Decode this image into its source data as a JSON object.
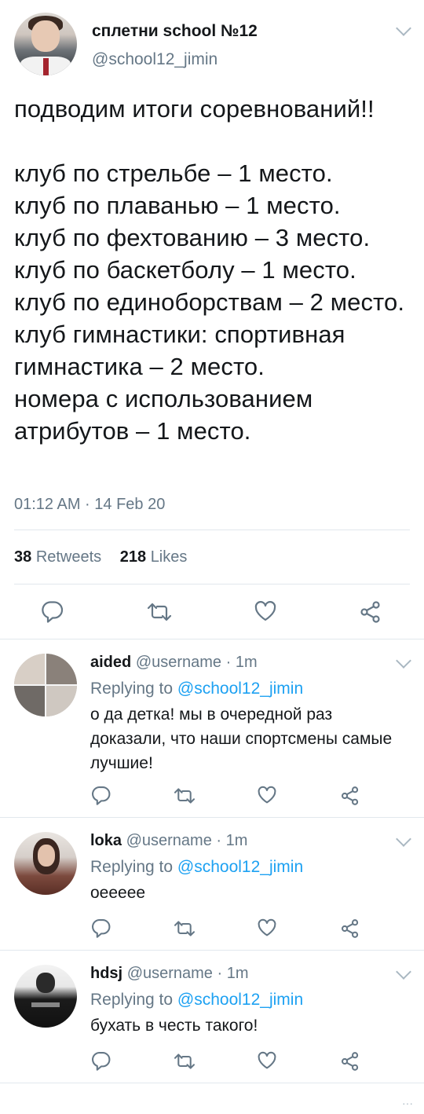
{
  "main_tweet": {
    "display_name": "сплетни school №12",
    "handle": "@school12_jimin",
    "text": "подводим итоги соревнований!!\n\nклуб по стрельбе – 1 место.\nклуб по плаванью – 1 место.\nклуб по фехтованию – 3 место.\nклуб по баскетболу – 1 место.\nклуб по единоборствам – 2 место.\nклуб гимнастики: спортивная гимнастика – 2 место.\nномера с использованием атрибутов – 1 место.",
    "timestamp": "01:12 AM · 14 Feb 20",
    "retweets_count": "38",
    "retweets_label": "Retweets",
    "likes_count": "218",
    "likes_label": "Likes"
  },
  "icons": {
    "reply": "reply-icon",
    "retweet": "retweet-icon",
    "like": "heart-icon",
    "share": "share-icon",
    "caret": "chevron-down-icon"
  },
  "replies": [
    {
      "name": "aided",
      "meta": "@username · 1m",
      "replying_prefix": "Replying to",
      "replying_handle": "@school12_jimin",
      "text": "о да детка! мы в очередной раз доказали, что наши спортсмены самые лучшие!"
    },
    {
      "name": "loka",
      "meta": "@username · 1m",
      "replying_prefix": "Replying to",
      "replying_handle": "@school12_jimin",
      "text": "оееееe"
    },
    {
      "name": "hdsj",
      "meta": "@username · 1m",
      "replying_prefix": "Replying to",
      "replying_handle": "@school12_jimin",
      "text": "бухать в честь такого!"
    }
  ],
  "colors": {
    "accent": "#1da1f2",
    "secondary_text": "#657786",
    "icon": "#657786",
    "divider": "#e1e8ed"
  }
}
